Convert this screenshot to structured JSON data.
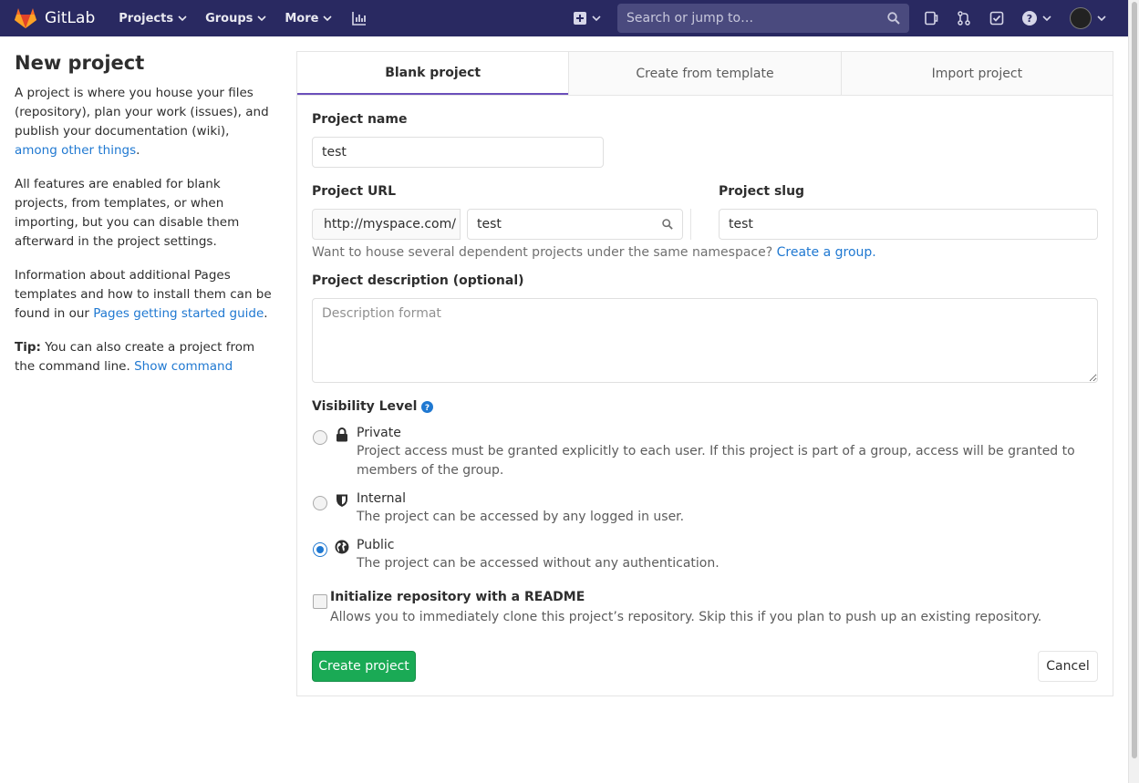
{
  "navbar": {
    "brand": "GitLab",
    "menu": [
      {
        "label": "Projects"
      },
      {
        "label": "Groups"
      },
      {
        "label": "More"
      }
    ],
    "search_placeholder": "Search or jump to…",
    "icons": [
      "activity-chart-icon",
      "plus-square-icon",
      "search-icon",
      "issues-icon",
      "merge-request-icon",
      "todo-icon",
      "help-icon",
      "avatar"
    ]
  },
  "sidebar": {
    "title": "New project",
    "para1_text": "A project is where you house your files (repository), plan your work (issues), and publish your documentation (wiki),",
    "para1_link": "among other things",
    "para1_end": ".",
    "para2": "All features are enabled for blank projects, from templates, or when importing, but you can disable them afterward in the project settings.",
    "para3_text": "Information about additional Pages templates and how to install them can be found in our",
    "para3_link": "Pages getting started guide",
    "para3_end": ".",
    "tip_label": "Tip:",
    "tip_text": "You can also create a project from the command line.",
    "tip_link": "Show command"
  },
  "tabs": [
    {
      "label": "Blank project",
      "active": true
    },
    {
      "label": "Create from template",
      "active": false
    },
    {
      "label": "Import project",
      "active": false
    }
  ],
  "form": {
    "project_name_label": "Project name",
    "project_name_value": "test",
    "project_url_label": "Project URL",
    "project_url_prefix": "http://myspace.com/",
    "project_url_namespace": "test",
    "project_slug_label": "Project slug",
    "project_slug_value": "test",
    "namespace_help": "Want to house several dependent projects under the same namespace?",
    "namespace_help_link": "Create a group.",
    "description_label": "Project description (optional)",
    "description_placeholder": "Description format",
    "visibility_label": "Visibility Level",
    "visibility_options": [
      {
        "title": "Private",
        "description": "Project access must be granted explicitly to each user. If this project is part of a group, access will be granted to members of the group.",
        "checked": false,
        "icon": "lock-icon"
      },
      {
        "title": "Internal",
        "description": "The project can be accessed by any logged in user.",
        "checked": false,
        "icon": "shield-icon"
      },
      {
        "title": "Public",
        "description": "The project can be accessed without any authentication.",
        "checked": true,
        "icon": "globe-icon"
      }
    ],
    "readme_label": "Initialize repository with a README",
    "readme_help": "Allows you to immediately clone this project’s repository. Skip this if you plan to push up an existing repository.",
    "readme_checked": false,
    "create_button": "Create project",
    "cancel_button": "Cancel"
  },
  "colors": {
    "navbar": "#292961",
    "link": "#1f78d1",
    "primary_button": "#1aaa55",
    "active_tab_border": "#6b4fbb"
  }
}
